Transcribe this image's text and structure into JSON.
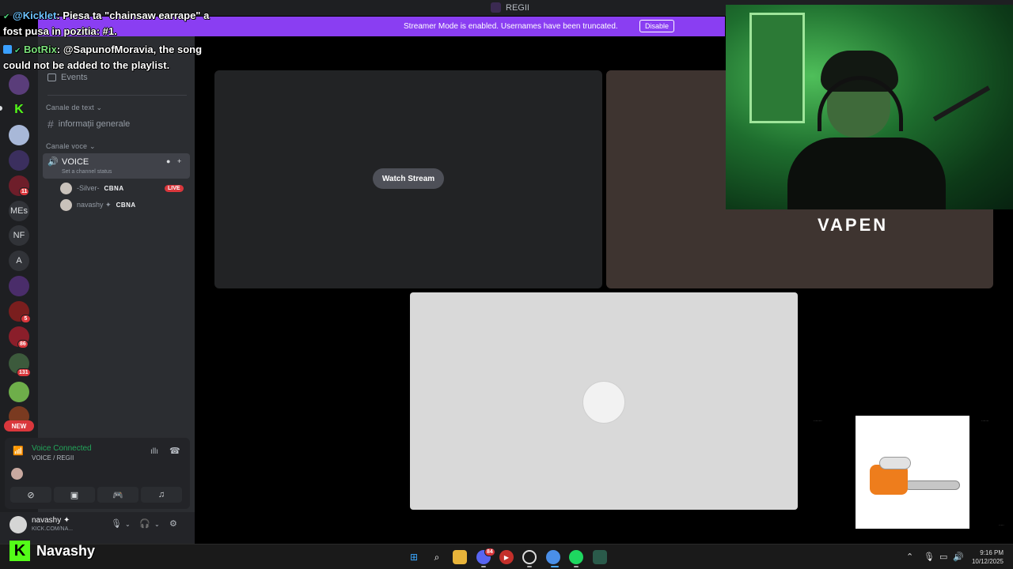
{
  "window": {
    "title": "REGII"
  },
  "banner": {
    "message": "Streamer Mode is enabled. Usernames have been truncated.",
    "disable_label": "Disable"
  },
  "rail": {
    "servers": [
      {
        "label": "",
        "color": "#5a3d7a"
      },
      {
        "label": "K",
        "color": "#1e1f22"
      },
      {
        "label": "",
        "color": "#a8b8d8"
      },
      {
        "label": "",
        "color": "#3b2f5e"
      },
      {
        "label": "",
        "color": "#6e1e2a"
      },
      {
        "label": "MEs",
        "color": "#313338"
      },
      {
        "label": "NF",
        "color": "#313338"
      },
      {
        "label": "A",
        "color": "#313338"
      },
      {
        "label": "",
        "color": "#4a2d6a"
      },
      {
        "label": "",
        "color": "#7a1e1e"
      },
      {
        "label": "",
        "color": "#8a1e2a"
      },
      {
        "label": "",
        "color": "#3c5a3c"
      },
      {
        "label": "",
        "color": "#6eae4a"
      },
      {
        "label": "",
        "color": "#7a3a20"
      }
    ],
    "badges": [
      "11",
      "5",
      "86",
      "131"
    ],
    "new_label": "NEW"
  },
  "sidebar": {
    "events_label": "Events",
    "text_category": "Canale de text",
    "text_channel": "informații generale",
    "voice_category": "Canale voce",
    "voice_channel": "VOICE",
    "voice_status": "Set a channel status",
    "voice_users": [
      {
        "name": "-Silver-",
        "tag": "CBNA",
        "live": "LIVE"
      },
      {
        "name": "navashy ✦",
        "tag": "CBNA",
        "live": ""
      }
    ]
  },
  "voice_panel": {
    "status": "Voice Connected",
    "path": "VOICE / REGII"
  },
  "user_bar": {
    "username": "navashy ✦",
    "substatus": "KICK.COM/NA..."
  },
  "stage": {
    "watch_label": "Watch Stream"
  },
  "overlay": {
    "brand": "VAPEN",
    "chat": [
      {
        "user": "@Kicklet",
        "text": ": Piesa ta \"chainsaw earrape\" a"
      },
      {
        "user": "",
        "text": "fost pusa in pozitia: #1."
      },
      {
        "user": "BotRix",
        "text": ": @SapunofMoravia, the song"
      },
      {
        "user": "",
        "text": "could not be added to the playlist."
      }
    ],
    "kick_name": "Navashy"
  },
  "taskbar": {
    "time": "9:16 PM",
    "date": "10/12/2025",
    "discord_badge": "84"
  }
}
